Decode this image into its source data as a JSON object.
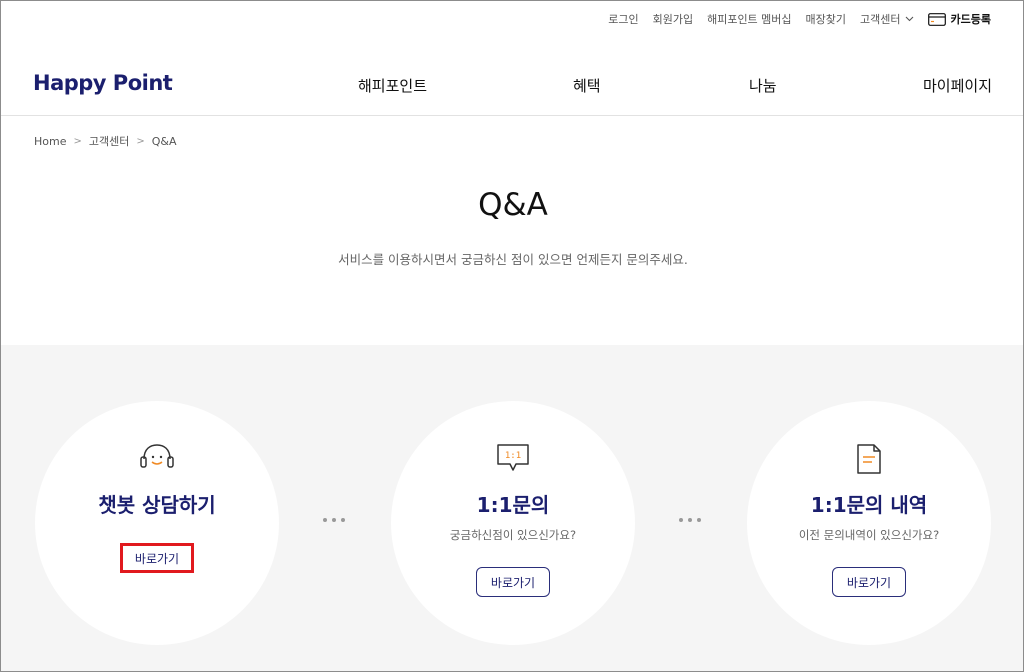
{
  "util": {
    "login": "로그인",
    "signup": "회원가입",
    "membership": "해피포인트 멤버십",
    "store": "매장찾기",
    "cs": "고객센터",
    "card": "카드등록"
  },
  "header": {
    "logo": "Happy Point",
    "nav": [
      "해피포인트",
      "혜택",
      "나눔",
      "마이페이지"
    ]
  },
  "breadcrumb": [
    "Home",
    "고객센터",
    "Q&A"
  ],
  "page": {
    "title": "Q&A",
    "description": "서비스를 이용하시면서 궁금하신 점이 있으면 언제든지 문의주세요."
  },
  "cards": [
    {
      "title": "챗봇 상담하기",
      "subtitle": "",
      "button": "바로가기",
      "icon": "headset-smile-icon"
    },
    {
      "title": "1:1문의",
      "subtitle": "궁금하신점이 있으신가요?",
      "button": "바로가기",
      "icon": "chat-bubble-icon",
      "icon_text": "1:1"
    },
    {
      "title": "1:1문의 내역",
      "subtitle": "이전 문의내역이 있으신가요?",
      "button": "바로가기",
      "icon": "document-icon"
    }
  ],
  "colors": {
    "brand": "#1b1f6e",
    "accent": "#f08a24",
    "highlight": "#e1191e",
    "section_bg": "#f5f5f5"
  }
}
